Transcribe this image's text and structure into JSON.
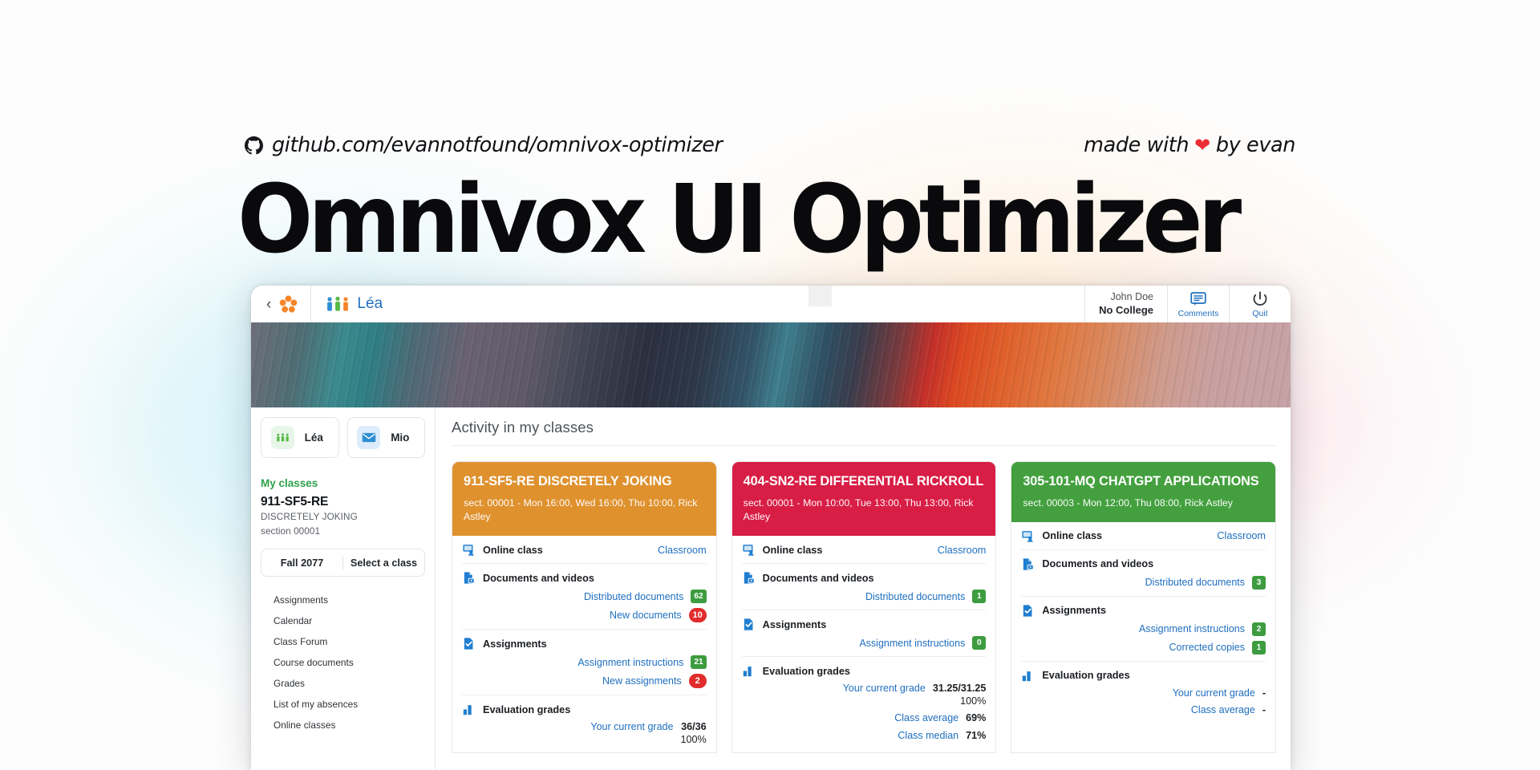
{
  "hero": {
    "github_icon": "github-icon",
    "github_text": "github.com/evannotfound/omnivox-optimizer",
    "made_with_prefix": "made with",
    "heart": "❤",
    "made_with_suffix": "by evan",
    "title": "Omnivox UI Optimizer"
  },
  "app": {
    "topbar": {
      "back": "‹",
      "logo_icon": "omnivox-flower-logo",
      "section_icon": "people-icon",
      "section_label": "Léa",
      "user_name": "John Doe",
      "user_org": "No College",
      "comments_label": "Comments",
      "comments_icon": "comments-icon",
      "quit_label": "Quit",
      "quit_icon": "power-icon"
    },
    "sidebar": {
      "tiles": [
        {
          "label": "Léa",
          "icon": "people-icon",
          "tone": "green"
        },
        {
          "label": "Mio",
          "icon": "envelope-icon",
          "tone": "blue"
        }
      ],
      "my_classes_label": "My classes",
      "current_class_code": "911-SF5-RE",
      "current_class_name": "DISCRETELY JOKING",
      "current_class_section": "section 00001",
      "term": "Fall 2077",
      "class_selector": "Select a class",
      "nav": [
        "Assignments",
        "Calendar",
        "Class Forum",
        "Course documents",
        "Grades",
        "List of my absences",
        "Online classes"
      ]
    },
    "main": {
      "title": "Activity in my classes",
      "cards": [
        {
          "color": "#df912e",
          "title": "911-SF5-RE DISCRETELY JOKING",
          "subtitle": "sect. 00001 - Mon 16:00, Wed 16:00, Thu 10:00, Rick Astley",
          "sections": [
            {
              "icon": "online-class-icon",
              "title": "Online class",
              "link": "Classroom",
              "rows": []
            },
            {
              "icon": "documents-icon",
              "title": "Documents and videos",
              "rows": [
                {
                  "label": "Distributed documents",
                  "badge": "62",
                  "badge_tone": "green"
                },
                {
                  "label": "New documents",
                  "badge": "10",
                  "badge_tone": "red"
                }
              ]
            },
            {
              "icon": "assignments-icon",
              "title": "Assignments",
              "rows": [
                {
                  "label": "Assignment instructions",
                  "badge": "21",
                  "badge_tone": "green"
                },
                {
                  "label": "New assignments",
                  "badge": "2",
                  "badge_tone": "red"
                }
              ]
            },
            {
              "icon": "grades-icon",
              "title": "Evaluation grades",
              "rows": [
                {
                  "label": "Your current grade",
                  "value": "36/36",
                  "pct": "100%"
                }
              ]
            }
          ]
        },
        {
          "color": "#d81e45",
          "title": "404-SN2-RE DIFFERENTIAL RICKROLL",
          "subtitle": "sect. 00001 - Mon 10:00, Tue 13:00, Thu 13:00, Rick Astley",
          "sections": [
            {
              "icon": "online-class-icon",
              "title": "Online class",
              "link": "Classroom",
              "rows": []
            },
            {
              "icon": "documents-icon",
              "title": "Documents and videos",
              "rows": [
                {
                  "label": "Distributed documents",
                  "badge": "1",
                  "badge_tone": "green"
                }
              ]
            },
            {
              "icon": "assignments-icon",
              "title": "Assignments",
              "rows": [
                {
                  "label": "Assignment instructions",
                  "badge": "0",
                  "badge_tone": "green"
                }
              ]
            },
            {
              "icon": "grades-icon",
              "title": "Evaluation grades",
              "rows": [
                {
                  "label": "Your current grade",
                  "value": "31.25/31.25",
                  "pct": "100%"
                },
                {
                  "label": "Class average",
                  "value": "69%"
                },
                {
                  "label": "Class median",
                  "value": "71%"
                }
              ]
            }
          ]
        },
        {
          "color": "#44a03f",
          "title": "305-101-MQ CHATGPT APPLICATIONS",
          "subtitle": "sect. 00003 - Mon 12:00, Thu 08:00, Rick Astley",
          "sections": [
            {
              "icon": "online-class-icon",
              "title": "Online class",
              "link": "Classroom",
              "rows": []
            },
            {
              "icon": "documents-icon",
              "title": "Documents and videos",
              "rows": [
                {
                  "label": "Distributed documents",
                  "badge": "3",
                  "badge_tone": "green"
                }
              ]
            },
            {
              "icon": "assignments-icon",
              "title": "Assignments",
              "rows": [
                {
                  "label": "Assignment instructions",
                  "badge": "2",
                  "badge_tone": "green"
                },
                {
                  "label": "Corrected copies",
                  "badge": "1",
                  "badge_tone": "green"
                }
              ]
            },
            {
              "icon": "grades-icon",
              "title": "Evaluation grades",
              "rows": [
                {
                  "label": "Your current grade",
                  "value": "-"
                },
                {
                  "label": "Class average",
                  "value": "-"
                }
              ]
            }
          ]
        }
      ]
    }
  }
}
